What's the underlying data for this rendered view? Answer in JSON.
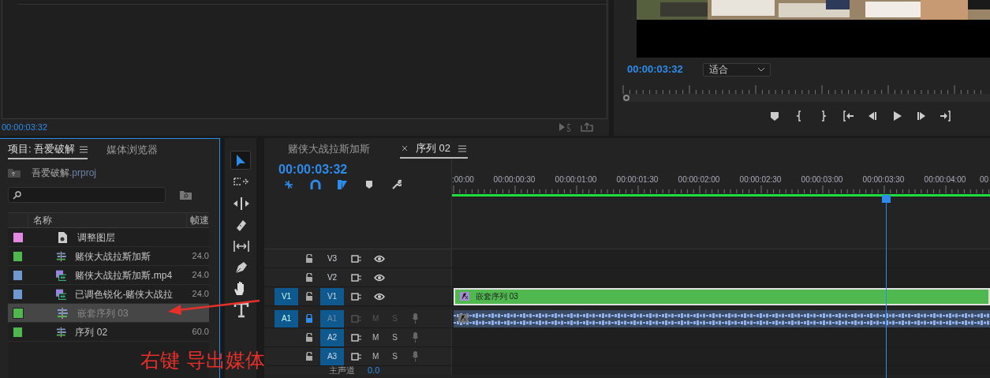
{
  "effects_panel": {
    "timecode": "00:00:03:32"
  },
  "program_monitor": {
    "timecode": "00:00:03:32",
    "zoom_select": "适合",
    "scrubber": {
      "level": 0
    }
  },
  "project_panel": {
    "tabs": [
      {
        "label": "项目: 吾爱破解",
        "selected": true
      },
      {
        "label": "媒体浏览器",
        "selected": false
      }
    ],
    "project_file": {
      "name": "吾爱破解",
      "ext": ".prproj"
    },
    "columns": [
      "名称",
      "帧速"
    ],
    "rows": [
      {
        "color": "#e388e3",
        "kind": "adjustment",
        "name": "调整图层",
        "selected": false
      },
      {
        "color": "#4fb84f",
        "kind": "sequence",
        "name": "赌侠大战拉斯加斯",
        "rate": "24.0",
        "selected": false
      },
      {
        "color": "#6f98d0",
        "kind": "clip",
        "name": "赌侠大战拉斯加斯.mp4",
        "rate": "24.0",
        "selected": false
      },
      {
        "color": "#6f98d0",
        "kind": "clip",
        "name": "已调色锐化-赌侠大战拉",
        "rate": "24.0",
        "selected": false
      },
      {
        "color": "#4fb84f",
        "kind": "sequence",
        "name": "嵌套序列 03",
        "selected": true
      },
      {
        "color": "#4fb84f",
        "kind": "sequence",
        "name": "序列 02",
        "rate": "60.0",
        "selected": false
      }
    ]
  },
  "tools": [
    {
      "kind": "select",
      "selected": true
    },
    {
      "kind": "track",
      "selected": false
    },
    {
      "kind": "ripple",
      "selected": false
    },
    {
      "kind": "razor",
      "selected": false
    },
    {
      "kind": "slip",
      "selected": false
    },
    {
      "kind": "pen",
      "selected": false
    },
    {
      "kind": "hand",
      "selected": false
    },
    {
      "kind": "type",
      "selected": false
    }
  ],
  "timeline": {
    "tabs": [
      {
        "label": "赌侠大战拉斯加斯",
        "selected": false
      },
      {
        "label": "序列 02",
        "selected": true
      }
    ],
    "timecode": "00:00:03:32",
    "ruler": [
      ":00:00",
      "00:00:00:30",
      "00:00:01:00",
      "00:00:01:30",
      "00:00:02:00",
      "00:00:02:30",
      "00:00:03:00",
      "00:00:03:30",
      "00:00:04:00",
      "00"
    ],
    "playhead": {
      "level": 0.807
    },
    "tracks": [
      {
        "kind": "video",
        "name": "V3",
        "targeted": false,
        "locked": false
      },
      {
        "kind": "video",
        "name": "V2",
        "targeted": false,
        "locked": false
      },
      {
        "kind": "video",
        "source": "V1",
        "name": "V1",
        "targeted": true,
        "locked": false,
        "clip": "嵌套序列 03"
      },
      {
        "kind": "audio",
        "source": "A1",
        "name": "A1",
        "targeted": true,
        "locked": true,
        "audio_clip": true,
        "mute": "M",
        "solo": "S"
      },
      {
        "kind": "audio",
        "name": "A2",
        "targeted": true,
        "locked": false,
        "audio_clip": false,
        "mute": "M",
        "solo": "S"
      },
      {
        "kind": "audio",
        "name": "A3",
        "targeted": true,
        "locked": false,
        "audio_clip": false,
        "mute": "M",
        "solo": "S"
      }
    ],
    "master": {
      "label": "主声道",
      "value": "0.0"
    }
  },
  "annotation": {
    "text": "右键 导出媒体"
  }
}
